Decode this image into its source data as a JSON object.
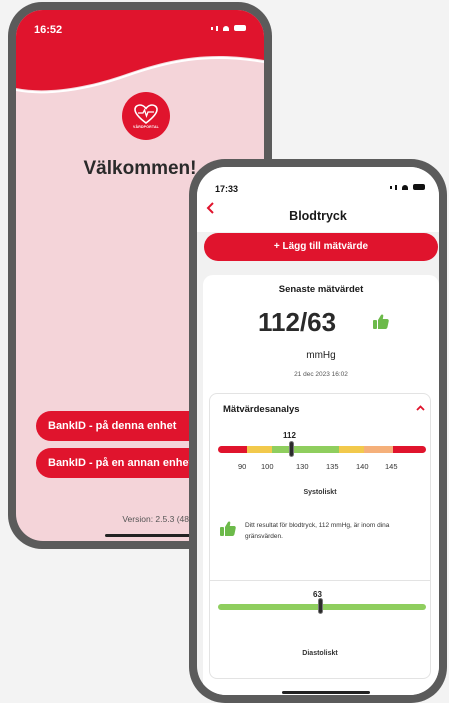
{
  "colors": {
    "accent": "#e0142d",
    "green": "#8fce5e",
    "yellow": "#f2c94c",
    "orange": "#f5b07a",
    "pink_bg": "#f4d4d9"
  },
  "login_screen": {
    "time": "16:52",
    "logo_text": "VÅRDPORTAL",
    "welcome": "Välkommen!",
    "bankid_this_device": "BankID - på denna enhet",
    "bankid_other_device": "BankID - på en annan enhet",
    "version": "Version: 2.5.3 (48759)"
  },
  "bp_screen": {
    "time": "17:33",
    "back_icon": "chevron-left-icon",
    "title": "Blodtryck",
    "add_button": "+ Lägg till mätvärde",
    "latest_label": "Senaste mätvärdet",
    "reading": "112/63",
    "unit": "mmHg",
    "date": "21 dec 2023 16:02",
    "analysis_title": "Mätvärdesanalys",
    "systolic": {
      "value": "112",
      "ticks": [
        "90",
        "100",
        "130",
        "135",
        "140",
        "145"
      ],
      "label": "Systoliskt"
    },
    "result_text": "Ditt resultat för blodtryck, 112 mmHg, är inom dina gränsvärden.",
    "diastolic": {
      "value": "63",
      "label": "Diastoliskt"
    }
  }
}
